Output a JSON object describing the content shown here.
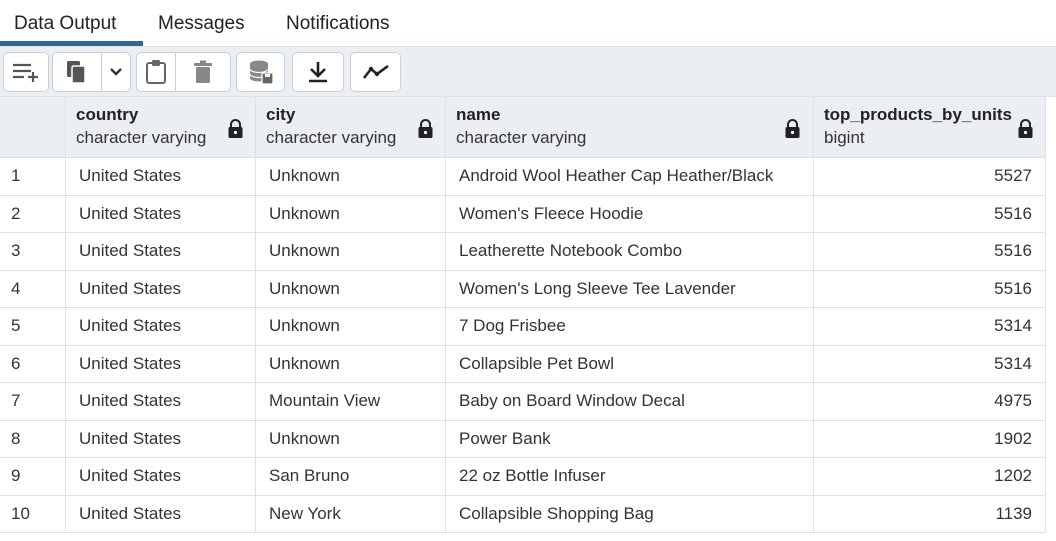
{
  "tabs": [
    {
      "label": "Data Output",
      "active": true
    },
    {
      "label": "Messages",
      "active": false
    },
    {
      "label": "Notifications",
      "active": false
    }
  ],
  "toolbar": [
    {
      "icon": "add-row-icon"
    },
    {
      "icon": "copy-icon"
    },
    {
      "icon": "chevron-down-icon"
    },
    {
      "icon": "paste-icon"
    },
    {
      "icon": "delete-icon"
    },
    {
      "icon": "save-data-changes-icon"
    },
    {
      "icon": "download-icon"
    },
    {
      "icon": "graph-visualiser-icon"
    }
  ],
  "columns": [
    {
      "name": "country",
      "type": "character varying"
    },
    {
      "name": "city",
      "type": "character varying"
    },
    {
      "name": "name",
      "type": "character varying"
    },
    {
      "name": "top_products_by_units",
      "type": "bigint"
    }
  ],
  "rows": [
    {
      "n": "1",
      "country": "United States",
      "city": "Unknown",
      "name": "Android Wool Heather Cap Heather/Black",
      "units": "5527"
    },
    {
      "n": "2",
      "country": "United States",
      "city": "Unknown",
      "name": "Women's Fleece Hoodie",
      "units": "5516"
    },
    {
      "n": "3",
      "country": "United States",
      "city": "Unknown",
      "name": "Leatherette Notebook Combo",
      "units": "5516"
    },
    {
      "n": "4",
      "country": "United States",
      "city": "Unknown",
      "name": "Women's Long Sleeve Tee Lavender",
      "units": "5516"
    },
    {
      "n": "5",
      "country": "United States",
      "city": "Unknown",
      "name": "7 Dog Frisbee",
      "units": "5314"
    },
    {
      "n": "6",
      "country": "United States",
      "city": "Unknown",
      "name": "Collapsible Pet Bowl",
      "units": "5314"
    },
    {
      "n": "7",
      "country": "United States",
      "city": "Mountain View",
      "name": "Baby on Board Window Decal",
      "units": "4975"
    },
    {
      "n": "8",
      "country": "United States",
      "city": "Unknown",
      "name": "Power Bank",
      "units": "1902"
    },
    {
      "n": "9",
      "country": "United States",
      "city": "San Bruno",
      "name": "22 oz Bottle Infuser",
      "units": "1202"
    },
    {
      "n": "10",
      "country": "United States",
      "city": "New York",
      "name": "Collapsible Shopping Bag",
      "units": "1139"
    }
  ],
  "colors": {
    "accent": "#326690",
    "header_bg": "#ebeef3",
    "border": "#dde0e6"
  }
}
